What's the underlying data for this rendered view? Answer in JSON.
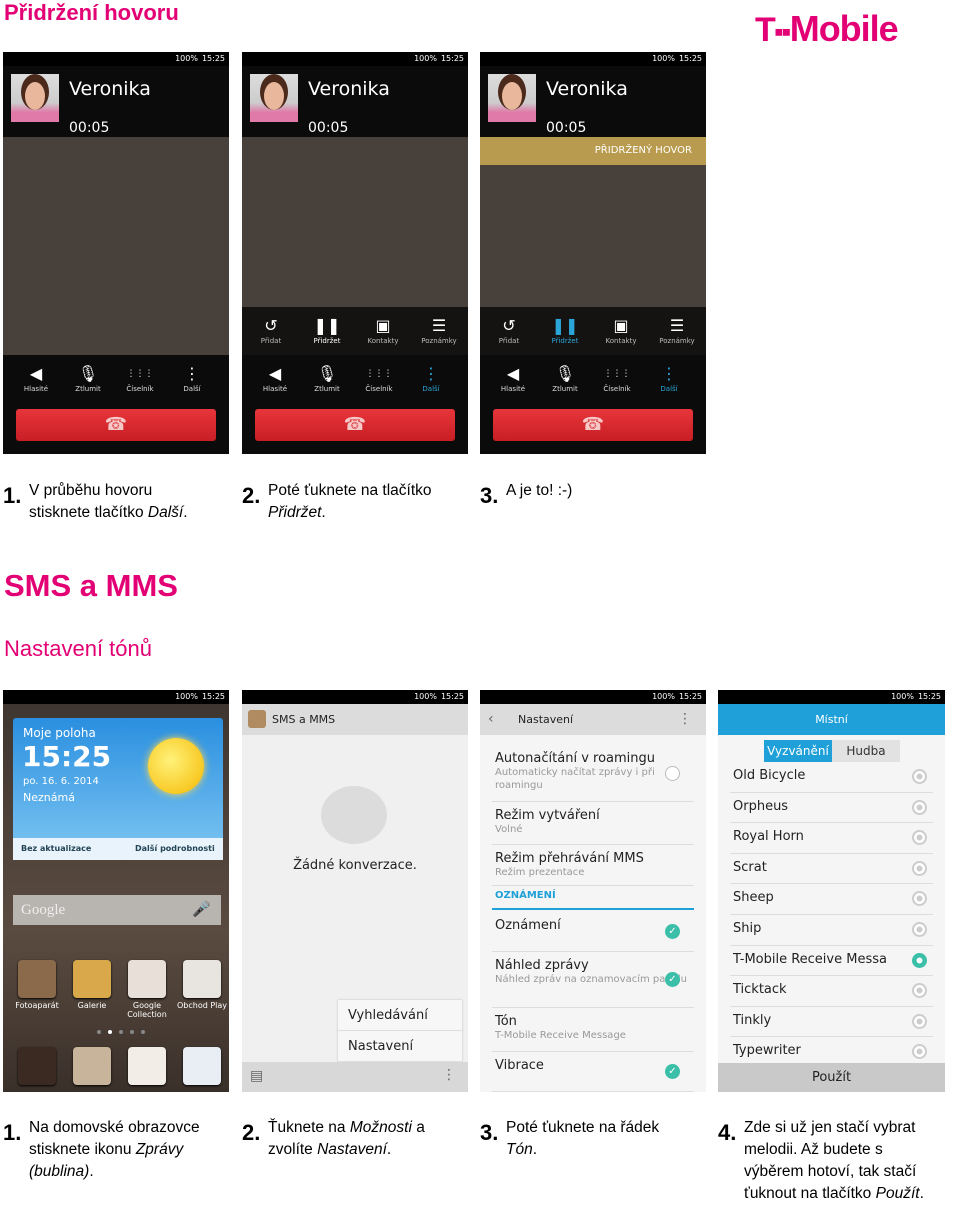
{
  "section1": {
    "title": "Přidržení hovoru"
  },
  "logo": {
    "text": "T··Mobile",
    "brand_color": "#e20074"
  },
  "status_bar": {
    "battery": "100%",
    "time": "15:25"
  },
  "call": {
    "contact": "Veronika",
    "timer": "00:05",
    "hold_banner": "PŘIDRŽENÝ HOVOR",
    "extra_buttons": [
      "Přidat",
      "Přidržet",
      "Kontakty",
      "Poznámky"
    ],
    "main_buttons": [
      "Hlasité",
      "Ztlumit",
      "Číselník",
      "Další"
    ]
  },
  "steps1": [
    {
      "num": "1.",
      "text": "V průběhu hovoru stisknete tlačítko ",
      "em": "Další",
      "end": "."
    },
    {
      "num": "2.",
      "text": "Poté ťuknete na tlačítko ",
      "em": "Přidržet",
      "end": "."
    },
    {
      "num": "3.",
      "text": "A je to! :-)",
      "em": "",
      "end": ""
    }
  ],
  "section2": {
    "title": "SMS a MMS",
    "subtitle": "Nastavení tónů"
  },
  "home": {
    "weather_location": "Moje poloha",
    "clock": "15:25",
    "date": "po. 16. 6. 2014",
    "place": "Neznámá",
    "refresh": "Bez aktualizace",
    "details": "Další podrobnosti",
    "search": "Google",
    "apps": [
      "Fotoaparát",
      "Galerie",
      "Google Collection",
      "Obchod Play"
    ]
  },
  "sms": {
    "title": "SMS a MMS",
    "empty": "Žádné konverzace.",
    "menu": [
      "Vyhledávání",
      "Nastavení"
    ]
  },
  "settings": {
    "title": "Nastavení",
    "items": [
      {
        "title": "Autonačítání v roamingu",
        "sub": "Automaticky načítat zprávy i při roamingu",
        "control": "radio-off"
      },
      {
        "title": "Režim vytváření",
        "sub": "Volné",
        "control": ""
      },
      {
        "title": "Režim přehrávání MMS",
        "sub": "Režim prezentace",
        "control": ""
      }
    ],
    "section": "OZNÁMENÍ",
    "items2": [
      {
        "title": "Oznámení",
        "sub": "",
        "control": "checked"
      },
      {
        "title": "Náhled zprávy",
        "sub": "Náhled zpráv na oznamovacím panelu",
        "control": "checked"
      },
      {
        "title": "Tón",
        "sub": "T-Mobile Receive Message",
        "control": ""
      },
      {
        "title": "Vibrace",
        "sub": "",
        "control": "checked"
      }
    ],
    "accent": "#1fa0d8"
  },
  "tones": {
    "title": "Místní",
    "tabs": [
      "Vyzvánění",
      "Hudba"
    ],
    "active_tab": 0,
    "items": [
      "Old Bicycle",
      "Orpheus",
      "Royal Horn",
      "Scrat",
      "Sheep",
      "Ship",
      "T-Mobile Receive Messa",
      "Ticktack",
      "Tinkly",
      "Typewriter"
    ],
    "selected": "T-Mobile Receive Messa",
    "apply": "Použít"
  },
  "steps2": [
    {
      "num": "1.",
      "text": "Na domovské obrazovce stisknete ikonu ",
      "em": "Zprávy (bublina)",
      "end": "."
    },
    {
      "num": "2.",
      "text": "Ťuknete na ",
      "em": "Možnosti",
      "end": " a zvolíte ",
      "em2": "Nastavení",
      "end2": "."
    },
    {
      "num": "3.",
      "text": "Poté ťuknete na řádek ",
      "em": "Tón",
      "end": "."
    },
    {
      "num": "4.",
      "text": "Zde si už jen stačí vybrat melodii. Až budete s výběrem hotoví, tak stačí ťuknout na tlačítko ",
      "em": "Použít",
      "end": "."
    }
  ]
}
